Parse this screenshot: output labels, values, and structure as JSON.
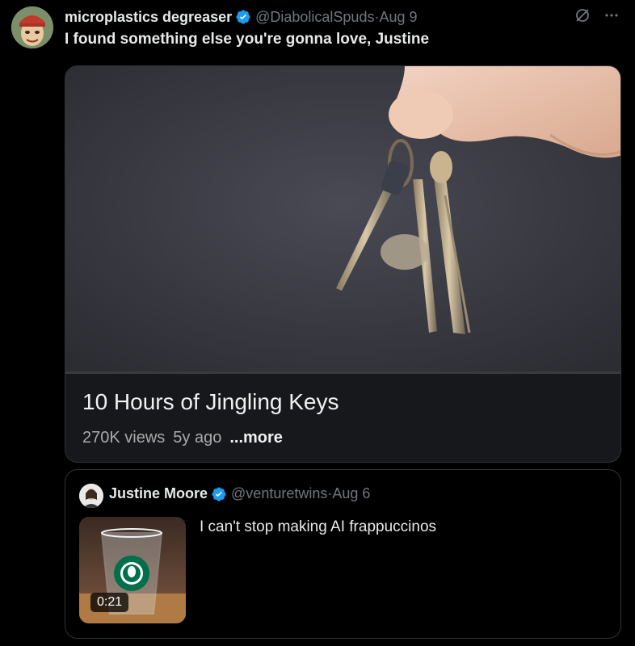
{
  "tweet": {
    "display_name": "microplastics degreaser",
    "handle": "@DiabolicalSpuds",
    "separator": " · ",
    "date": "Aug 9",
    "text": "I found something else you're gonna love, Justine",
    "verified": true,
    "icons": [
      "grok-icon",
      "more-options-icon"
    ]
  },
  "video_card": {
    "title": "10 Hours of Jingling Keys",
    "views": "270K views",
    "age": "5y ago",
    "more": "...more",
    "progress": 0.0
  },
  "quoted_tweet": {
    "display_name": "Justine Moore",
    "handle": "@venturetwins",
    "separator": " · ",
    "date": "Aug 6",
    "text": "I can't stop making AI frappuccinos",
    "video_duration": "0:21",
    "verified": true
  },
  "colors": {
    "background": "#000000",
    "verified_blue": "#1d9bf0",
    "secondary_text": "#71767b",
    "border": "#2f3336",
    "video_progress": "#ff0000"
  }
}
